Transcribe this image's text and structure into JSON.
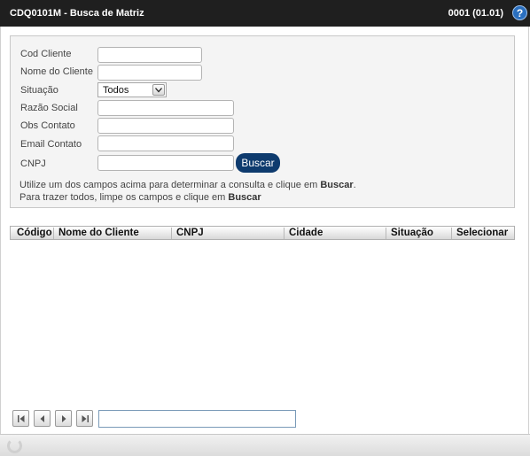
{
  "window": {
    "title": "CDQ0101M - Busca de Matriz",
    "page_code": "0001 (01.01)",
    "help_glyph": "?"
  },
  "filters": {
    "cod_cliente": {
      "label": "Cod Cliente",
      "value": ""
    },
    "nome_cliente": {
      "label": "Nome do Cliente",
      "value": ""
    },
    "situacao": {
      "label": "Situação",
      "value": "Todos"
    },
    "razao_social": {
      "label": "Razão Social",
      "value": ""
    },
    "obs_contato": {
      "label": "Obs Contato",
      "value": ""
    },
    "email_contato": {
      "label": "Email Contato",
      "value": ""
    },
    "cnpj": {
      "label": "CNPJ",
      "value": ""
    },
    "search_button": "Buscar",
    "hint1_text": "Utilize um dos campos acima para determinar a consulta e clique em ",
    "hint1_bold": "Buscar",
    "hint1_end": ".",
    "hint2_text": "Para trazer todos, limpe os campos e clique em ",
    "hint2_bold": "Buscar"
  },
  "grid": {
    "columns": [
      "Código",
      "Nome do Cliente",
      "CNPJ",
      "Cidade",
      "Situação",
      "Selecionar"
    ],
    "rows": []
  },
  "pager": {
    "first_icon": "first-page-icon",
    "prev_icon": "prev-page-icon",
    "next_icon": "next-page-icon",
    "last_icon": "last-page-icon",
    "page_value": ""
  },
  "colors": {
    "titlebar": "#1f1f1f",
    "button": "#0e3b6e",
    "help": "#2a6fbf"
  }
}
